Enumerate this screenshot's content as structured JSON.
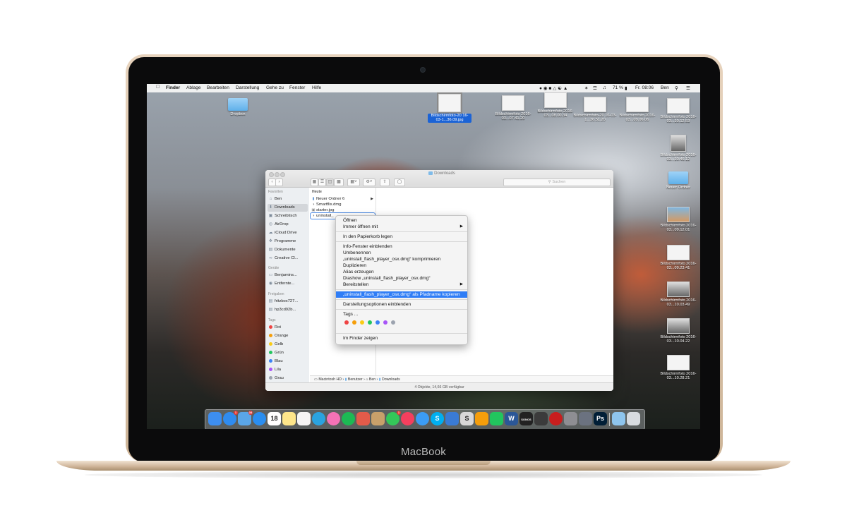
{
  "device": {
    "brand": "MacBook"
  },
  "menubar": {
    "items": [
      "Finder",
      "Ablage",
      "Bearbeiten",
      "Darstellung",
      "Gehe zu",
      "Fenster",
      "Hilfe"
    ],
    "battery": "71 %",
    "clock": "Fr. 08:06",
    "user": "Ben"
  },
  "desktop": {
    "icons": [
      {
        "label": "Dropbox",
        "kind": "folder"
      },
      {
        "label": "Bildschirmfoto-20 16-03-1...36.09.jpg",
        "kind": "screenshot",
        "selected": true
      },
      {
        "label": "Bildschirmfoto 2016-03...07.41.20",
        "kind": "screenshot"
      },
      {
        "label": "Bildschirmfoto 2016-03...08.00.34",
        "kind": "screenshot"
      },
      {
        "label": "Bildschirmfoto-20 16-03-1...36.51.20",
        "kind": "screenshot"
      },
      {
        "label": "Bildschirmfoto 2016-03...09.06.06",
        "kind": "screenshot"
      },
      {
        "label": "Bildschirmfoto 2016-03...10.12.53",
        "kind": "screenshot"
      },
      {
        "label": "Bildschirmfoto 2016-03...10.46.12",
        "kind": "screenshot"
      },
      {
        "label": "Neuer Ordner",
        "kind": "folder"
      },
      {
        "label": "Bildschirmfoto 2016-03...09.12.01",
        "kind": "screenshot"
      },
      {
        "label": "Bildschirmfoto 2016-03...09.23.41",
        "kind": "screenshot"
      },
      {
        "label": "Bildschirmfoto 2016-03...10.03.49",
        "kind": "screenshot"
      },
      {
        "label": "Bildschirmfoto 2016-03...10.04.22",
        "kind": "screenshot"
      },
      {
        "label": "Bildschirmfoto 2016-03...10.28.21",
        "kind": "screenshot"
      }
    ]
  },
  "finder": {
    "title": "Downloads",
    "search_placeholder": "Suchen",
    "sidebar": {
      "favorites_header": "Favoriten",
      "favorites": [
        "Ben",
        "Downloads",
        "Schreibtisch",
        "AirDrop",
        "iCloud Drive",
        "Programme",
        "Dokumente",
        "Creative Cl..."
      ],
      "selected": "Downloads",
      "devices_header": "Geräte",
      "devices": [
        "Benjamins...",
        "Entfernte..."
      ],
      "shared_header": "Freigaben",
      "shared": [
        "fritzbox727...",
        "hp3cd92b..."
      ],
      "tags_header": "Tags",
      "tags": [
        {
          "name": "Rot",
          "color": "#ef4444"
        },
        {
          "name": "Orange",
          "color": "#f59e0b"
        },
        {
          "name": "Gelb",
          "color": "#facc15"
        },
        {
          "name": "Grün",
          "color": "#22c55e"
        },
        {
          "name": "Blau",
          "color": "#3b82f6"
        },
        {
          "name": "Lila",
          "color": "#a855f7"
        },
        {
          "name": "Grau",
          "color": "#9ca3af"
        }
      ]
    },
    "column": {
      "header": "Heute",
      "items": [
        {
          "name": "Neuer Ordner 6",
          "icon": "folder-icon",
          "has_children": true
        },
        {
          "name": "Smartflix.dmg",
          "icon": "disk-image-icon"
        },
        {
          "name": "starter.jpg",
          "icon": "image-file-icon"
        },
        {
          "name": "uninstall_",
          "icon": "disk-image-icon",
          "selected": true
        }
      ]
    },
    "pathbar": [
      "Macintosh HD",
      "Benutzer",
      "Ben",
      "Downloads"
    ],
    "status": "4 Objekte, 14,66 GB verfügbar"
  },
  "context_menu": {
    "items": [
      {
        "label": "Öffnen"
      },
      {
        "label": "Immer öffnen mit",
        "submenu": true
      },
      {
        "label": "In den Papierkorb legen"
      },
      {
        "label": "Info-Fenster einblenden"
      },
      {
        "label": "Umbenennen"
      },
      {
        "label": "„uninstall_flash_player_osx.dmg“ komprimieren"
      },
      {
        "label": "Duplizieren"
      },
      {
        "label": "Alias erzeugen"
      },
      {
        "label": "Diashow „uninstall_flash_player_osx.dmg“"
      },
      {
        "label": "Bereitstellen",
        "submenu": true
      },
      {
        "label": "„uninstall_flash_player_osx.dmg“ als Pfadname kopieren",
        "highlighted": true
      },
      {
        "label": "Darstellungsoptionen einblenden"
      },
      {
        "label": "Tags ..."
      },
      {
        "label": "Im Finder zeigen"
      }
    ],
    "tag_colors": [
      "#ef4444",
      "#f59e0b",
      "#facc15",
      "#22c55e",
      "#3b82f6",
      "#a855f7",
      "#9ca3af"
    ]
  },
  "dock": {
    "apps": [
      {
        "name": "finder-icon",
        "color": "#3d8ef0",
        "badge": ""
      },
      {
        "name": "app-store-icon",
        "color": "#2f8cf0",
        "badge": "1"
      },
      {
        "name": "mail-icon",
        "color": "#5aa6e8",
        "badge": "34"
      },
      {
        "name": "safari-icon",
        "color": "#2a8ef0",
        "badge": ""
      },
      {
        "name": "calendar-icon",
        "color": "#ffffff",
        "badge": "",
        "text": "18"
      },
      {
        "name": "notes-icon",
        "color": "#fde68a",
        "badge": ""
      },
      {
        "name": "reminders-icon",
        "color": "#f5f5f5",
        "badge": ""
      },
      {
        "name": "telegram-icon",
        "color": "#2aa3df",
        "badge": ""
      },
      {
        "name": "photos-icon",
        "color": "#f472b6",
        "badge": ""
      },
      {
        "name": "spotify-icon",
        "color": "#1db954",
        "badge": ""
      },
      {
        "name": "wunderlist-icon",
        "color": "#e25b4a",
        "badge": ""
      },
      {
        "name": "contacts-icon",
        "color": "#c8a06a",
        "badge": ""
      },
      {
        "name": "facetime-icon",
        "color": "#34c759",
        "badge": "1"
      },
      {
        "name": "itunes-icon",
        "color": "#f43f5e",
        "badge": ""
      },
      {
        "name": "messages-icon",
        "color": "#3b9cf5",
        "badge": ""
      },
      {
        "name": "skype-icon",
        "color": "#00aff0",
        "badge": "",
        "text": "S"
      },
      {
        "name": "feather-icon",
        "color": "#3a7bd5",
        "badge": ""
      },
      {
        "name": "scrivener-icon",
        "color": "#d8d8d8",
        "badge": "",
        "text": "S"
      },
      {
        "name": "pages-icon",
        "color": "#f59e0b",
        "badge": ""
      },
      {
        "name": "numbers-icon",
        "color": "#22c55e",
        "badge": ""
      },
      {
        "name": "word-icon",
        "color": "#2b5797",
        "badge": "",
        "text": "W"
      },
      {
        "name": "sonos-icon",
        "color": "#222222",
        "badge": "",
        "text": "SONOS"
      },
      {
        "name": "audio-icon",
        "color": "#3b3b3b",
        "badge": ""
      },
      {
        "name": "opera-icon",
        "color": "#c81e1e",
        "badge": ""
      },
      {
        "name": "settings-icon",
        "color": "#8e8e93",
        "badge": ""
      },
      {
        "name": "system-preferences-icon",
        "color": "#6b7280",
        "badge": ""
      },
      {
        "name": "photoshop-icon",
        "color": "#001e36",
        "badge": "",
        "text": "Ps"
      }
    ],
    "trailing": [
      {
        "name": "downloads-folder-icon",
        "color": "#8ec5ee"
      },
      {
        "name": "trash-icon",
        "color": "#d7dbe0"
      }
    ]
  }
}
